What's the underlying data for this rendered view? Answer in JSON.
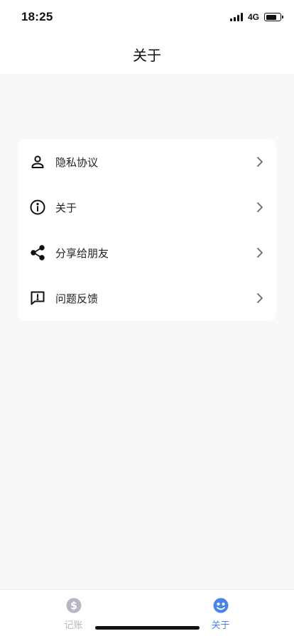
{
  "status_bar": {
    "time": "18:25",
    "network": "4G",
    "signal_bars": 4,
    "battery_level": 0.8
  },
  "nav": {
    "title": "关于"
  },
  "menu": {
    "items": [
      {
        "label": "隐私协议",
        "icon": "person-icon"
      },
      {
        "label": "关于",
        "icon": "info-icon"
      },
      {
        "label": "分享给朋友",
        "icon": "share-icon"
      },
      {
        "label": "问题反馈",
        "icon": "feedback-icon"
      }
    ]
  },
  "tab_bar": {
    "tabs": [
      {
        "label": "记账",
        "icon": "dollar-coin-icon",
        "active": false
      },
      {
        "label": "关于",
        "icon": "smiley-face-icon",
        "active": true
      }
    ]
  },
  "colors": {
    "accent": "#4a84e8",
    "inactive": "#b6b6c0",
    "background": "#f8f8fa",
    "card": "#ffffff"
  }
}
